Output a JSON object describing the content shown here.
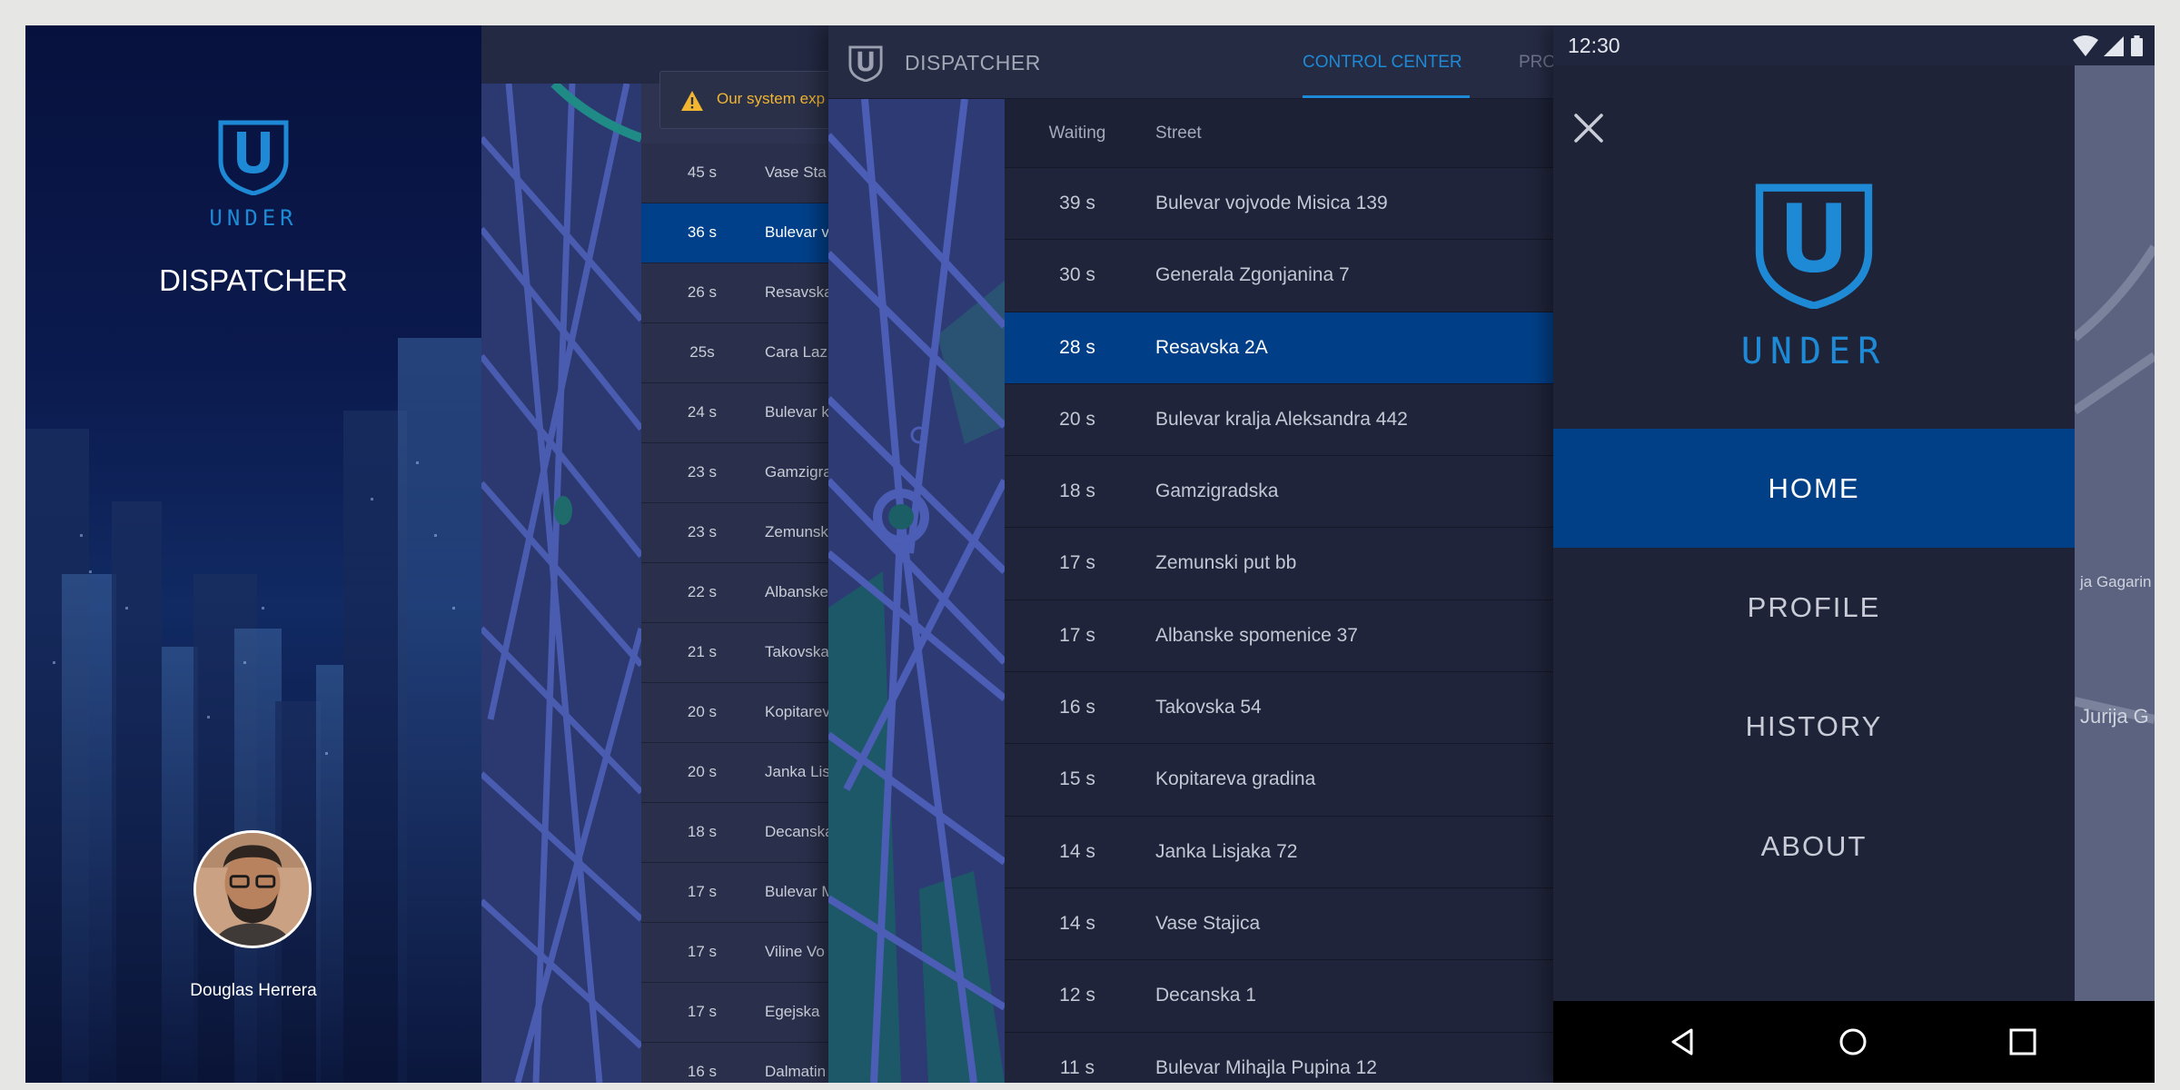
{
  "brand": {
    "name": "UNDER",
    "product": "DISPATCHER",
    "accent_color": "#1e8ad6",
    "highlight_color": "#003f87"
  },
  "login": {
    "user_name": "Douglas Herrera"
  },
  "table_back": {
    "alert_text": "Our system exp",
    "rows": [
      {
        "wait": "45 s",
        "street": "Vase Sta"
      },
      {
        "wait": "36 s",
        "street": "Bulevar v"
      },
      {
        "wait": "26 s",
        "street": "Resavska"
      },
      {
        "wait": "25s",
        "street": "Cara Laz"
      },
      {
        "wait": "24 s",
        "street": "Bulevar k"
      },
      {
        "wait": "23 s",
        "street": "Gamzigra"
      },
      {
        "wait": "23 s",
        "street": "Zemunsk"
      },
      {
        "wait": "22 s",
        "street": "Albanske"
      },
      {
        "wait": "21 s",
        "street": "Takovska"
      },
      {
        "wait": "20 s",
        "street": "Kopitarev"
      },
      {
        "wait": "20 s",
        "street": "Janka Lis"
      },
      {
        "wait": "18 s",
        "street": "Decanska"
      },
      {
        "wait": "17 s",
        "street": "Bulevar M"
      },
      {
        "wait": "17 s",
        "street": "Viline Vo"
      },
      {
        "wait": "17 s",
        "street": "Egejska"
      },
      {
        "wait": "16 s",
        "street": "Dalmatin"
      }
    ]
  },
  "control_center": {
    "app_title": "DISPATCHER",
    "tabs": [
      {
        "label": "CONTROL CENTER",
        "active": true
      },
      {
        "label": "PRO",
        "active": false
      }
    ],
    "columns": {
      "waiting": "Waiting",
      "street": "Street"
    },
    "rows": [
      {
        "wait": "39 s",
        "street": "Bulevar vojvode Misica 139"
      },
      {
        "wait": "30 s",
        "street": "Generala Zgonjanina 7"
      },
      {
        "wait": "28 s",
        "street": "Resavska 2A"
      },
      {
        "wait": "20 s",
        "street": "Bulevar kralja Aleksandra 442"
      },
      {
        "wait": "18 s",
        "street": "Gamzigradska"
      },
      {
        "wait": "17 s",
        "street": "Zemunski put bb"
      },
      {
        "wait": "17 s",
        "street": "Albanske spomenice 37"
      },
      {
        "wait": "16 s",
        "street": "Takovska 54"
      },
      {
        "wait": "15 s",
        "street": "Kopitareva gradina"
      },
      {
        "wait": "14 s",
        "street": "Janka Lisjaka 72"
      },
      {
        "wait": "14 s",
        "street": "Vase Stajica"
      },
      {
        "wait": "12 s",
        "street": "Decanska 1"
      },
      {
        "wait": "11 s",
        "street": "Bulevar Mihajla Pupina 12"
      }
    ]
  },
  "mobile": {
    "status_time": "12:30",
    "brand": "UNDER",
    "nav": [
      {
        "label": "HOME",
        "active": true
      },
      {
        "label": "PROFILE",
        "active": false
      },
      {
        "label": "HISTORY",
        "active": false
      },
      {
        "label": "ABOUT",
        "active": false
      }
    ],
    "map_labels": [
      "ja Gagarin",
      "Jurija G"
    ]
  }
}
